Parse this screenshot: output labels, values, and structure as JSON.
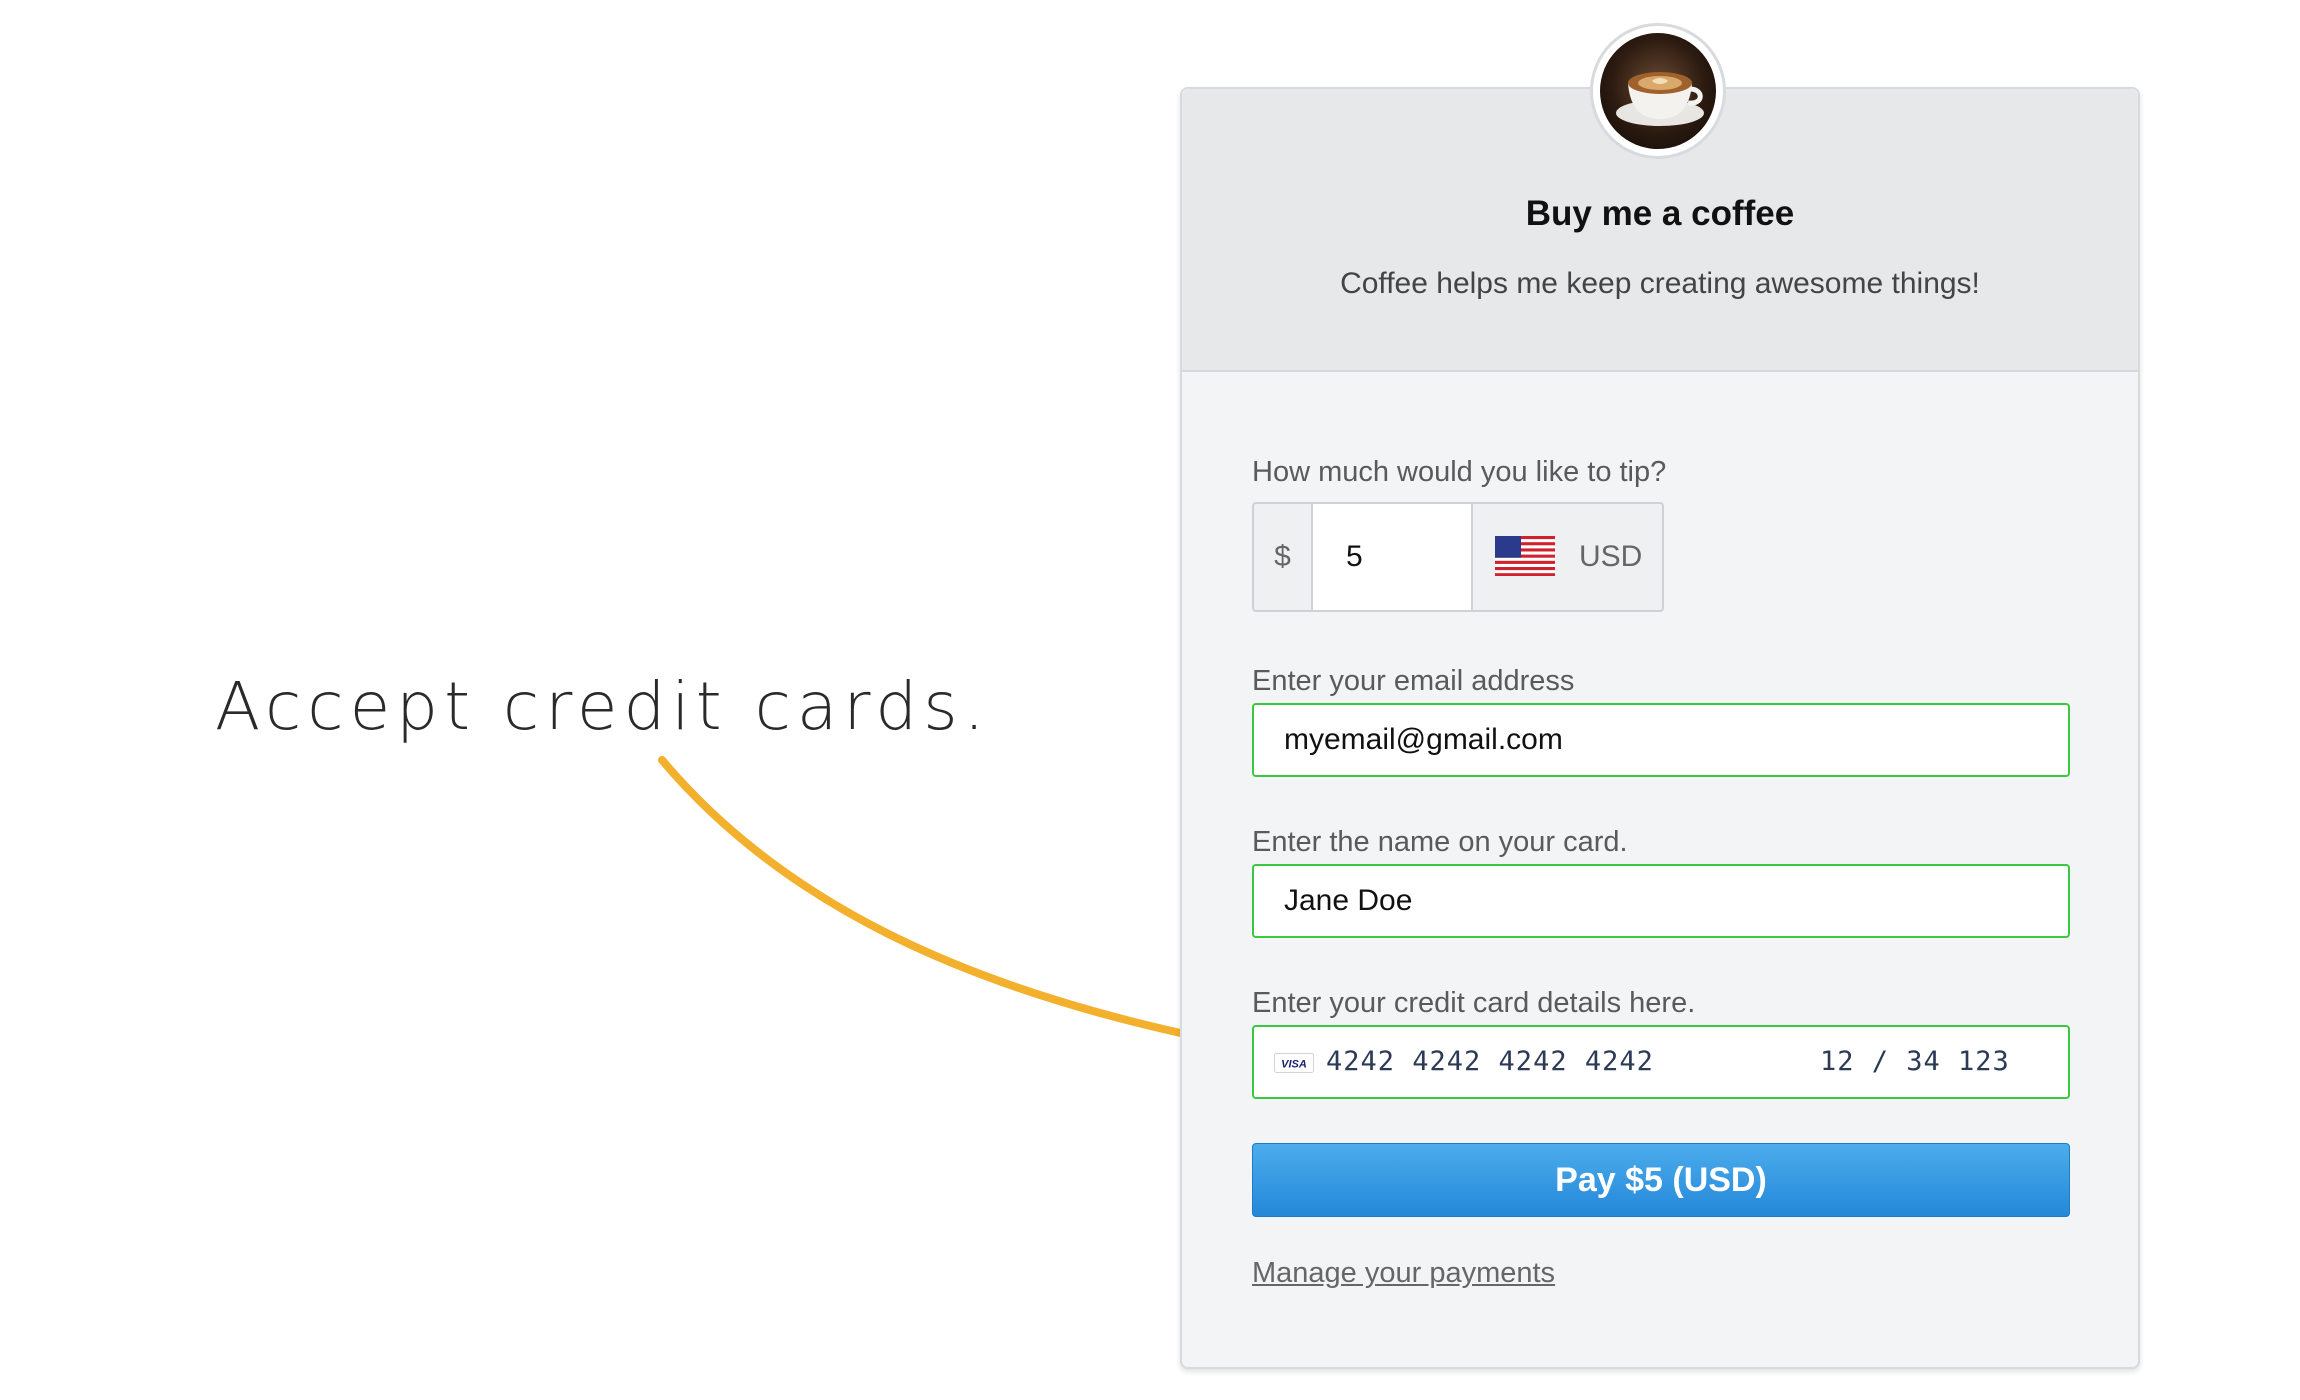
{
  "annotation": {
    "caption": "Accept credit cards.",
    "arrow_color": "#f2b02c"
  },
  "header": {
    "avatar_icon": "coffee-cup-icon",
    "title": "Buy me a coffee",
    "subtitle": "Coffee helps me keep creating awesome things!"
  },
  "tip": {
    "label": "How much would you like to tip?",
    "currency_symbol": "$",
    "amount": "5",
    "currency_flag_icon": "us-flag-icon",
    "currency_code": "USD"
  },
  "email": {
    "label": "Enter your email address",
    "value": "myemail@gmail.com"
  },
  "name": {
    "label": "Enter the name on your card.",
    "value": "Jane Doe"
  },
  "card": {
    "label": "Enter your credit card details here.",
    "brand_icon": "visa-icon",
    "brand_text": "VISA",
    "number": "4242 4242 4242 4242",
    "exp_cvc": "12 / 34 123"
  },
  "pay_button": {
    "label": "Pay $5 (USD)",
    "color": "#2f95e0"
  },
  "manage_link": {
    "label": "Manage your payments"
  },
  "colors": {
    "valid_border": "#38c93e"
  }
}
